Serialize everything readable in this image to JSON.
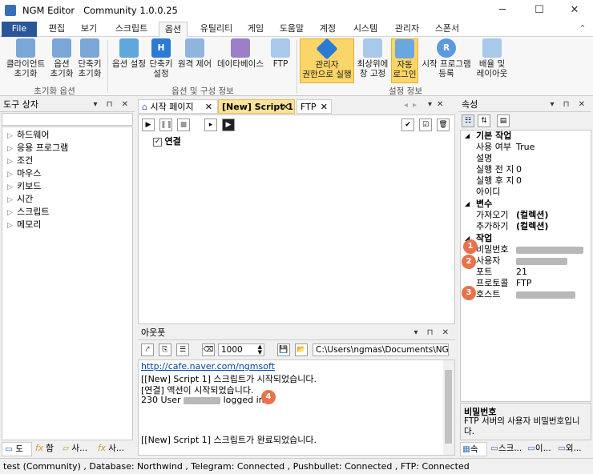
{
  "window": {
    "app_name": "NGM Editor",
    "edition": "Community 1.0.0.25"
  },
  "menu": {
    "file": "File",
    "tabs": [
      "편집",
      "보기",
      "스크립트",
      "옵션",
      "유틸리티",
      "게임",
      "도움말",
      "계정",
      "시스템",
      "관리자",
      "스폰서"
    ],
    "active_tab": "옵션"
  },
  "ribbon": {
    "group1": {
      "label": "초기화 옵션",
      "buttons": [
        "클라이언트\n초기화",
        "옵션\n초기화",
        "단축키\n초기화"
      ]
    },
    "group2": {
      "label": "옵션 및 구성 정보",
      "buttons": [
        "옵션 설정",
        "단축키\n설정",
        "원격 제어",
        "데이타베이스",
        "FTP"
      ]
    },
    "group3": {
      "label": "설정 정보",
      "buttons": [
        "관리자\n권한으로 실행",
        "최상위에\n창 고정",
        "자동\n로그인",
        "시작 프로그램\n등록",
        "배율 및\n레이아웃"
      ]
    }
  },
  "toolbox": {
    "title": "도구 상자",
    "items": [
      "하드웨어",
      "응용 프로그램",
      "조건",
      "마우스",
      "키보드",
      "시간",
      "스크립트",
      "메모리"
    ],
    "bottom_tabs": [
      "도",
      "함",
      "사...",
      "사..."
    ]
  },
  "editor": {
    "tabs": [
      "시작 페이지",
      "[New] Script 1",
      "FTP"
    ],
    "active_tab": "[New] Script 1",
    "script_item": "연결"
  },
  "output": {
    "title": "아웃풋",
    "count_value": "1000",
    "path_value": "C:\\Users\\ngmas\\Documents\\NGM5\\",
    "lines": {
      "link": "http://cafe.naver.com/ngmsoft",
      "l1": "[[New] Script 1] 스크립트가 시작되었습니다.",
      "l2": "[연결] 액션이 시작되었습니다.",
      "l3_pre": "230 User",
      "l3_post": "logged in",
      "l4": "[[New] Script 1] 스크립트가 완료되었습니다."
    }
  },
  "properties": {
    "title": "속성",
    "cat_basic": "기본 작업",
    "basic": [
      {
        "name": "사용 여부",
        "value": "True"
      },
      {
        "name": "설명",
        "value": ""
      },
      {
        "name": "실행 전 지",
        "value": "0"
      },
      {
        "name": "실행 후 지",
        "value": "0"
      },
      {
        "name": "아이디",
        "value": ""
      }
    ],
    "cat_var": "변수",
    "vars": [
      {
        "name": "가져오기",
        "value": "(컬렉션)"
      },
      {
        "name": "추가하기",
        "value": "(컬렉션)"
      }
    ],
    "cat_task": "작업",
    "task": [
      {
        "name": "비밀번호",
        "value": ""
      },
      {
        "name": "사용자",
        "value": ""
      },
      {
        "name": "포트",
        "value": "21"
      },
      {
        "name": "프로토콜",
        "value": "FTP"
      },
      {
        "name": "호스트",
        "value": ""
      }
    ],
    "desc_title": "비밀번호",
    "desc_text": "FTP 서버의 사용자 비밀번호입니다.",
    "bottom_tabs": [
      "속",
      "스크...",
      "이...",
      "외..."
    ]
  },
  "badges": [
    "1",
    "2",
    "3",
    "4"
  ],
  "status": "test (Community) , Database: Northwind , Telegram: Connected , Pushbullet: Connected , FTP: Connected"
}
